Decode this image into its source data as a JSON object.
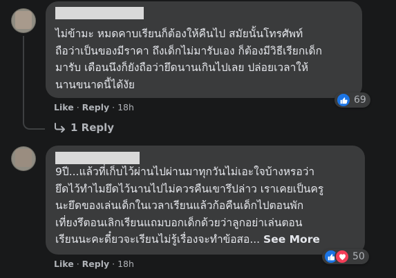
{
  "comments": [
    {
      "text": "ไม่ข้ามะ หมดคาบเรียนก็ต้องให้คืนไป สมัยนั้นโทรศัพท์\nถือว่าเป็นของมีราคา ถึงเด็กไม่มารับเอง ก็ต้องมีวิธีเรียกเด็ก\nมารับ เดือนนึงก็ยังถือว่ายึดนานเกินไปเลย ปล่อยเวลาให้\nนานขนาดนี้ได้งัย",
      "actions": {
        "like": "Like",
        "reply": "Reply",
        "time": "18h"
      },
      "reactions": {
        "count": "69"
      },
      "reply_link": "1 Reply"
    },
    {
      "text": "9ปี...แล้วที่เก็บไว้ผ่านไปผ่านมาทุกวันไม่เอะใจบ้างหรอว่า\nยึดไว้ทำไมยึดไว้นานไปไม่ควรคืนเขารึปล่าว เราเคยเป็นครู\nนะยึดของเล่นเด็กในเวลาเรียนแล้วก้อคืนเด็กไปตอนพัก\nเที่ยงรึตอนเลิกเรียนแถมบอกเด็กด้วยว่าลูกอย่าเล่นตอน\nเรียนนะคะดี๋ยวจะเรียนไม่รู้เรื่องจะทำข้อสอ...",
      "see_more": "See More",
      "actions": {
        "like": "Like",
        "reply": "Reply",
        "time": "18h"
      },
      "reactions": {
        "count": "50"
      }
    }
  ],
  "separator": "·",
  "colors": {
    "background": "#18191a",
    "bubble": "#3a3b3c",
    "like": "#1b74e4",
    "love": "#f33e58"
  },
  "icons": {
    "like": "thumbs-up-icon",
    "love": "heart-icon",
    "reply_arrow": "reply-arrow-icon"
  }
}
